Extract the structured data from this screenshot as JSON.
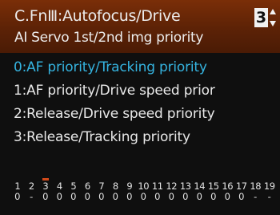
{
  "header": {
    "title": "C.FnⅢ:Autofocus/Drive",
    "subtitle": "AI Servo 1st/2nd img priority",
    "page_number": "3"
  },
  "options": [
    {
      "label": "0:AF priority/Tracking priority",
      "selected": true
    },
    {
      "label": "1:AF priority/Drive speed prior",
      "selected": false
    },
    {
      "label": "2:Release/Drive speed priority",
      "selected": false
    },
    {
      "label": "3:Release/Tracking priority",
      "selected": false
    }
  ],
  "function_settings": [
    {
      "num": "1",
      "val": "0"
    },
    {
      "num": "2",
      "val": "-"
    },
    {
      "num": "3",
      "val": "0",
      "current": true
    },
    {
      "num": "4",
      "val": "0"
    },
    {
      "num": "5",
      "val": "0"
    },
    {
      "num": "6",
      "val": "0"
    },
    {
      "num": "7",
      "val": "0"
    },
    {
      "num": "8",
      "val": "0"
    },
    {
      "num": "9",
      "val": "0"
    },
    {
      "num": "10",
      "val": "0"
    },
    {
      "num": "11",
      "val": "0"
    },
    {
      "num": "12",
      "val": "0"
    },
    {
      "num": "13",
      "val": "0"
    },
    {
      "num": "14",
      "val": "0"
    },
    {
      "num": "15",
      "val": "0"
    },
    {
      "num": "16",
      "val": "0"
    },
    {
      "num": "17",
      "val": "0"
    },
    {
      "num": "18",
      "val": "-"
    },
    {
      "num": "19",
      "val": "-"
    }
  ],
  "colors": {
    "header_bg": "#5c2206",
    "selected_text": "#35b3df",
    "current_marker": "#d24a1a"
  }
}
